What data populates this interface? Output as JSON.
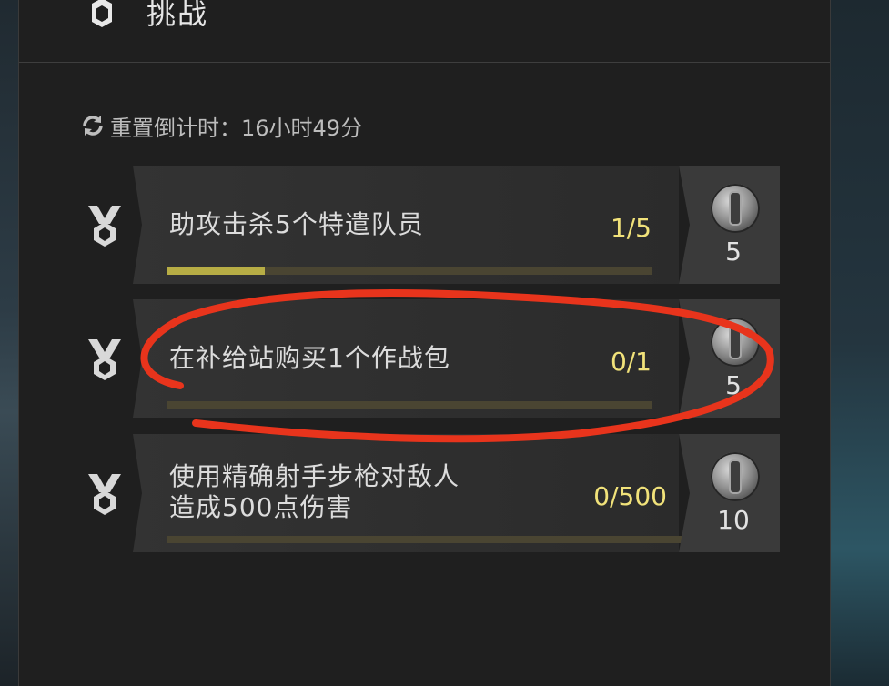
{
  "header": {
    "title": "挑战",
    "icon": "hexagon-badge-icon"
  },
  "reset": {
    "label": "重置倒计时：16小时49分",
    "icon": "refresh-icon"
  },
  "tasks": [
    {
      "title": "助攻击杀5个特遣队员",
      "progress": "1/5",
      "progress_fraction": 0.2,
      "reward": "5",
      "reward_icon": "silver-coin-icon",
      "medal_icon": "medal-icon"
    },
    {
      "title": "在补给站购买1个作战包",
      "progress": "0/1",
      "progress_fraction": 0,
      "reward": "5",
      "reward_icon": "silver-coin-icon",
      "medal_icon": "medal-icon"
    },
    {
      "title_line1": "使用精确射手步枪对敌人",
      "title_line2": "造成500点伤害",
      "progress": "0/500",
      "progress_fraction": 0,
      "reward": "10",
      "reward_icon": "silver-coin-icon",
      "medal_icon": "medal-icon"
    }
  ],
  "colors": {
    "accent_yellow": "#f1e27a",
    "progress_fill": "#b7ad45",
    "annotation_red": "#e8341c"
  }
}
